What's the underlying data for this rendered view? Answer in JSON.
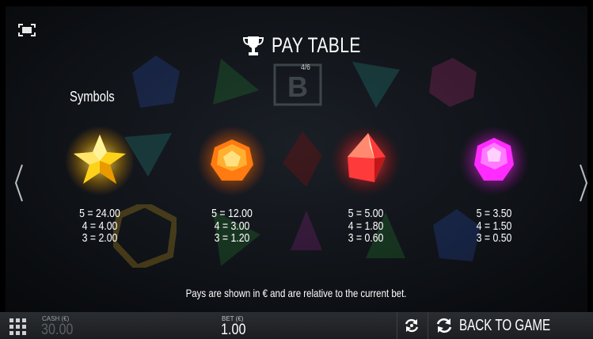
{
  "header": {
    "title": "PAY TABLE",
    "page_indicator": "4/6",
    "icon": "trophy-icon"
  },
  "section": {
    "title": "Symbols"
  },
  "symbols": [
    {
      "name": "yellow-star-gem",
      "color": "#ffd21a",
      "pays": [
        "5 = 24.00",
        "4 = 4.00",
        "3 = 2.00"
      ]
    },
    {
      "name": "orange-gem",
      "color": "#ff8a10",
      "pays": [
        "5 = 12.00",
        "4 = 3.00",
        "3 = 1.20"
      ]
    },
    {
      "name": "red-gem",
      "color": "#ff3a3a",
      "pays": [
        "5 = 5.00",
        "4 = 1.80",
        "3 = 0.60"
      ]
    },
    {
      "name": "purple-gem",
      "color": "#ff2bff",
      "pays": [
        "5 = 3.50",
        "4 = 1.50",
        "3 = 0.50"
      ]
    }
  ],
  "note": "Pays are shown in € and are relative to the current bet.",
  "bottom_bar": {
    "cash_label": "CASH (€)",
    "cash_value": "30.00",
    "bet_label": "BET (€)",
    "bet_value": "1.00",
    "back_label": "BACK TO GAME"
  }
}
